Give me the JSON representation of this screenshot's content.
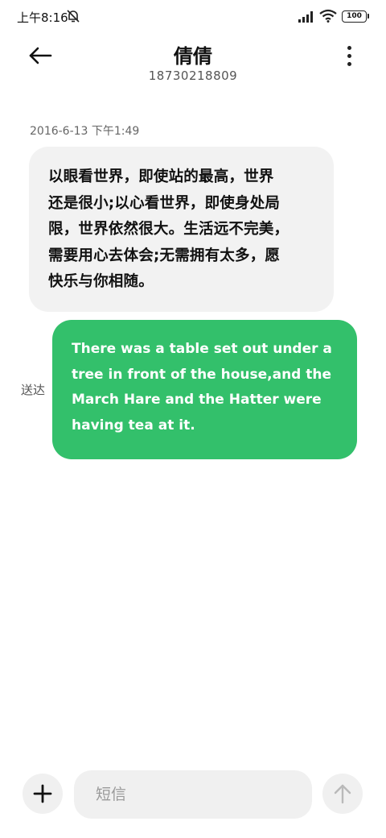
{
  "status_bar": {
    "time": "上午8:16",
    "battery": "100",
    "icons": [
      "mute-icon",
      "signal-icon",
      "wifi-icon",
      "battery-icon"
    ]
  },
  "header": {
    "title": "倩倩",
    "subtitle": "18730218809",
    "icons": [
      "back-arrow-icon",
      "more-vertical-icon"
    ]
  },
  "conversation": {
    "timestamp": "2016-6-13  下午1:49",
    "messages": [
      {
        "direction": "incoming",
        "lines": [
          "以眼看世界，即使站的最高，世界",
          "还是很小;以心看世界，即使身处局",
          "限，世界依然很大。生活远不完美，",
          "需要用心去体会;无需拥有太多，愿",
          "快乐与你相随。"
        ]
      },
      {
        "direction": "outgoing",
        "status": "送达",
        "lines": [
          "There was a table set out under a",
          "tree in front of the house,and the",
          "March Hare and the Hatter were",
          "having tea at it."
        ]
      }
    ]
  },
  "composer": {
    "placeholder": "短信",
    "value": "",
    "icons": [
      "plus-icon",
      "send-arrow-icon"
    ]
  },
  "colors": {
    "outgoing_bubble": "#33c06b",
    "incoming_bubble": "#f2f2f2",
    "background": "#ffffff"
  }
}
